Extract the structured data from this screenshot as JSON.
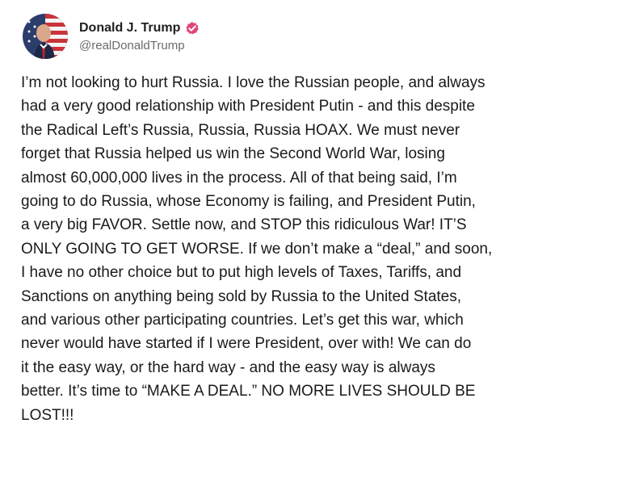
{
  "post": {
    "author": {
      "display_name": "Donald J. Trump",
      "handle": "@realDonaldTrump",
      "verified_icon": "verified-badge-icon",
      "verified_color": "#e0457b",
      "avatar_icon": "profile-avatar"
    },
    "body_lines": [
      "I’m not looking to hurt Russia. I love the Russian people, and always",
      "had a very good relationship with President Putin - and this despite",
      "the Radical Left’s Russia, Russia, Russia HOAX. We must never",
      "forget that Russia helped us win the Second World War, losing",
      "almost 60,000,000 lives in the process. All of that being said, I’m",
      "going to do Russia, whose Economy is failing, and President Putin,",
      "a very big FAVOR. Settle now, and STOP this ridiculous War! IT’S",
      "ONLY GOING TO GET WORSE. If we don’t make a “deal,” and soon,",
      "I have no other choice but to put high levels of Taxes, Tariffs, and",
      "Sanctions on anything being sold by Russia to the United States,",
      "and various other participating countries. Let’s get this war, which",
      "never would have started if I were President, over with! We can do",
      "it the easy way, or the hard way - and the easy way is always",
      "better. It’s time to “MAKE A DEAL.” NO MORE LIVES SHOULD BE",
      "LOST!!!"
    ]
  }
}
